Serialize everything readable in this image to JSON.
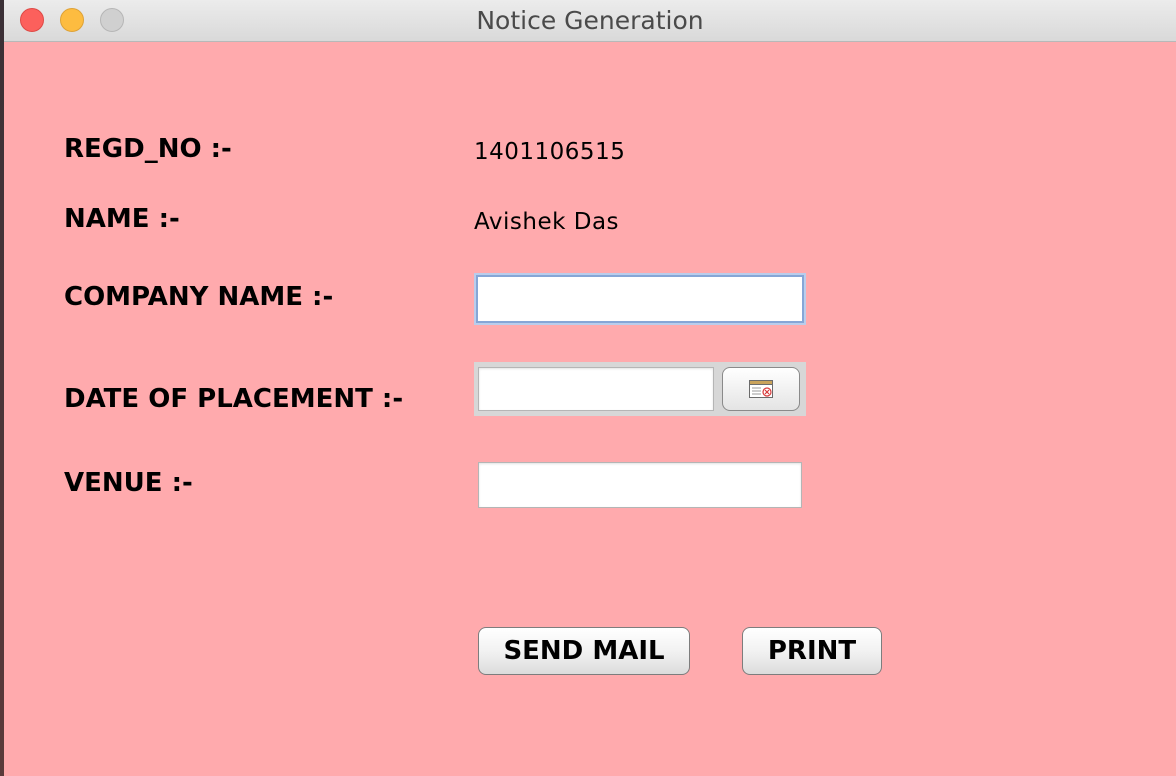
{
  "window": {
    "title": "Notice Generation"
  },
  "form": {
    "regd_no": {
      "label": "REGD_NO :-",
      "value": "1401106515"
    },
    "name": {
      "label": "NAME :-",
      "value": "Avishek Das"
    },
    "company_name": {
      "label": "COMPANY NAME :-",
      "value": "",
      "focused": true
    },
    "date_of_placement": {
      "label": "DATE OF PLACEMENT :-",
      "value": "",
      "picker_icon": "calendar-icon"
    },
    "venue": {
      "label": "VENUE :-",
      "value": ""
    }
  },
  "buttons": {
    "send_mail": "SEND MAIL",
    "print": "PRINT"
  },
  "colors": {
    "background": "#ffaaad",
    "close": "#fc605c",
    "minimize": "#fdbc40",
    "zoom": "#d0d0d0",
    "focus_ring": "#86a6d6"
  }
}
